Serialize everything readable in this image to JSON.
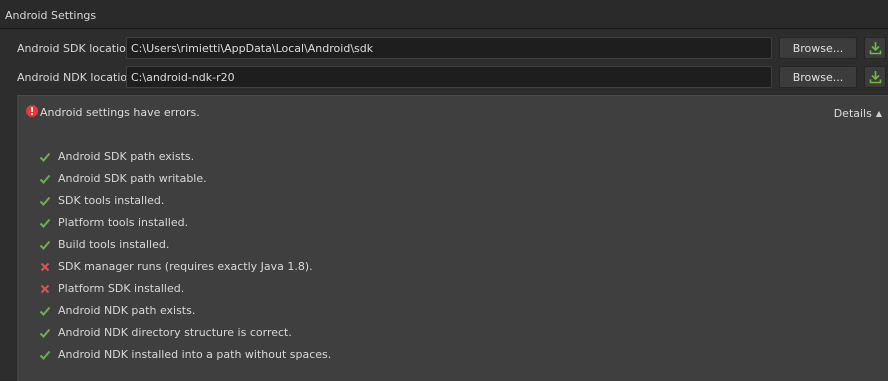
{
  "panel_title": "Android Settings",
  "sdk": {
    "label": "Android SDK location:",
    "path": "C:\\Users\\rimietti\\AppData\\Local\\Android\\sdk",
    "browse_label": "Browse..."
  },
  "ndk": {
    "label": "Android NDK location:",
    "path": "C:\\android-ndk-r20",
    "browse_label": "Browse..."
  },
  "errors": {
    "message": "Android settings have errors.",
    "details_label": "Details",
    "checks": [
      {
        "text": "Android SDK path exists.",
        "ok": true
      },
      {
        "text": "Android SDK path writable.",
        "ok": true
      },
      {
        "text": "SDK tools installed.",
        "ok": true
      },
      {
        "text": "Platform tools installed.",
        "ok": true
      },
      {
        "text": "Build tools installed.",
        "ok": true
      },
      {
        "text": "SDK manager runs (requires exactly Java 1.8).",
        "ok": false
      },
      {
        "text": "Platform SDK installed.",
        "ok": false
      },
      {
        "text": "Android NDK path exists.",
        "ok": true
      },
      {
        "text": "Android NDK directory structure is correct.",
        "ok": true
      },
      {
        "text": "Android NDK installed into a path without spaces.",
        "ok": true
      }
    ]
  },
  "colors": {
    "ok": "#6ab04c",
    "fail": "#e05050",
    "error_icon": "#e0393e",
    "download": "#6fba3f"
  },
  "icons": {
    "ok": "check-icon",
    "fail": "cross-icon",
    "error": "error-icon",
    "download": "download-icon",
    "caret": "caret-up-icon"
  }
}
